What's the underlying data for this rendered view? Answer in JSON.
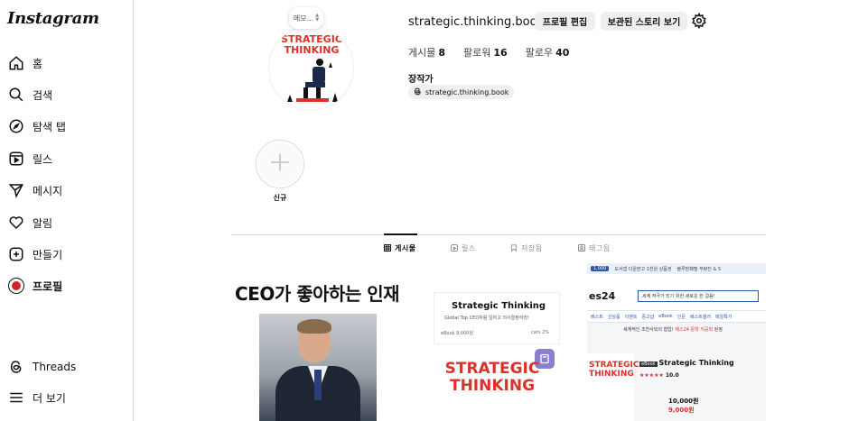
{
  "sidebar": {
    "logo": "Instagram",
    "items": [
      {
        "label": "홈",
        "icon": "home-icon"
      },
      {
        "label": "검색",
        "icon": "search-icon"
      },
      {
        "label": "탐색 탭",
        "icon": "compass-icon"
      },
      {
        "label": "릴스",
        "icon": "reels-icon"
      },
      {
        "label": "메시지",
        "icon": "send-icon"
      },
      {
        "label": "알림",
        "icon": "heart-icon"
      },
      {
        "label": "만들기",
        "icon": "plus-square-icon"
      },
      {
        "label": "프로필",
        "icon": "avatar"
      }
    ],
    "bottom": [
      {
        "label": "Threads",
        "icon": "threads-icon"
      },
      {
        "label": "더 보기",
        "icon": "menu-icon"
      }
    ]
  },
  "profile": {
    "memo": "메모...",
    "avatar_lines": [
      "STRATEGIC",
      "THINKING"
    ],
    "username": "strategic.thinking.book",
    "edit_label": "프로필 편집",
    "archive_label": "보관된 스토리 보기",
    "stats": {
      "posts_label": "게시물",
      "posts": "8",
      "followers_label": "팔로워",
      "followers": "16",
      "following_label": "팔로우",
      "following": "40"
    },
    "category": "장작가",
    "threads_handle": "strategic.thinking.book"
  },
  "highlight": {
    "label": "신규"
  },
  "tabs": [
    {
      "label": "게시물",
      "active": true
    },
    {
      "label": "릴스",
      "active": false
    },
    {
      "label": "저장됨",
      "active": false
    },
    {
      "label": "태그됨",
      "active": false
    }
  ],
  "posts": {
    "p1": {
      "headline": "CEO가 좋아하는 인재"
    },
    "p2": {
      "title": "Strategic Thinking",
      "subtitle": "Global Top CEO처럼 일하고 의사결정하라!",
      "ebook": "eBook",
      "cars": "cars",
      "ebook_price": "9,000원",
      "cars_price": "2%",
      "big_title_1": "STRATEGIC",
      "big_title_2": "THINKING"
    },
    "p3": {
      "banner_pill": "1,000",
      "banner_text": "도서앱 다운받고 1천원 상품권",
      "banner_right": "블루방패텔 무량진 & 5",
      "site": "es24",
      "search_text": "세계 적극가 되기 위한 새로운 한 걸음!",
      "nav": [
        "베스트",
        "신상품",
        "이벤트",
        "중고샵",
        "eBook",
        "인문",
        "베스트셀러",
        "매일특가"
      ],
      "note_prefix": "세계적인 조찬사외의 협업! ",
      "note_red": "예스24 문학 지공외",
      "note_suffix": " 된정",
      "thumb_1": "STRATEGIC",
      "thumb_2": "THINKING",
      "tag": "eBook",
      "product_name": "Strategic Thinking",
      "rating": "10.0",
      "price": "10,000원",
      "sale_price": "9,000원"
    }
  },
  "colors": {
    "accent_red": "#d8322a",
    "border": "#dbdbdb",
    "button_bg": "#efefef"
  }
}
